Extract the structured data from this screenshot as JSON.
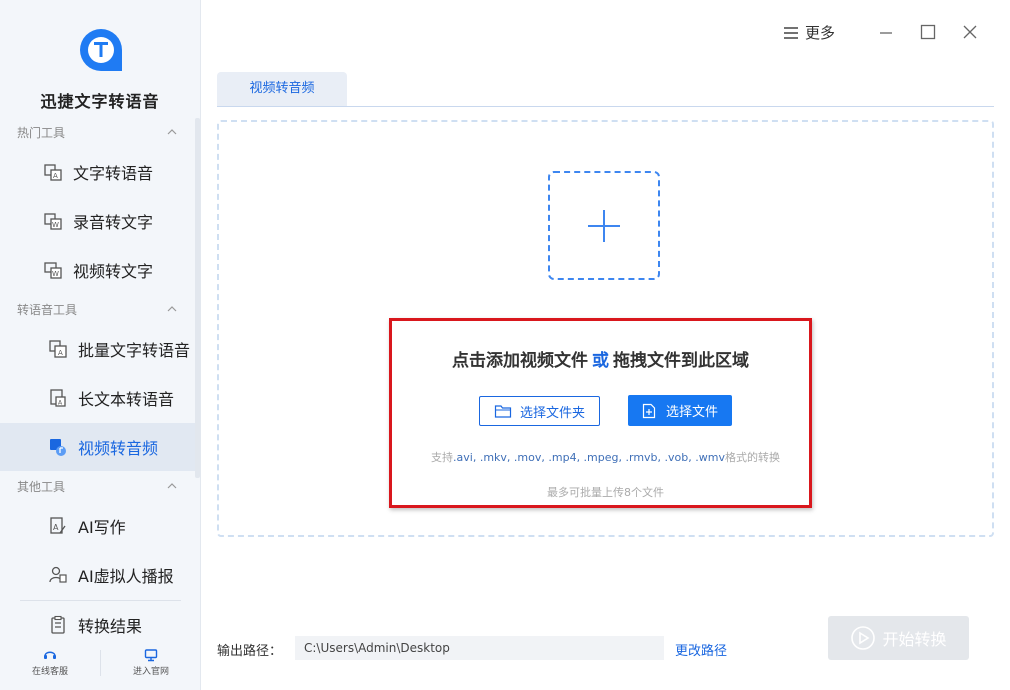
{
  "app": {
    "name": "迅捷文字转语音"
  },
  "sidebar": {
    "groups": [
      {
        "title": "热门工具",
        "items": [
          "文字转语音",
          "录音转文字",
          "视频转文字"
        ]
      },
      {
        "title": "转语音工具",
        "items": [
          "批量文字转语音",
          "长文本转语音",
          "视频转音频"
        ]
      },
      {
        "title": "其他工具",
        "items": [
          "AI写作",
          "AI虚拟人播报",
          "转换结果"
        ]
      }
    ],
    "active_item": "视频转音频",
    "bottom": {
      "service": "在线客服",
      "website": "进入官网"
    }
  },
  "topbar": {
    "more_label": "更多"
  },
  "tabs": [
    {
      "label": "视频转音频"
    }
  ],
  "dropzone": {
    "prompt_part1": "点击添加视频文件",
    "prompt_or": "或",
    "prompt_part2": "拖拽文件到此区域",
    "folder_button": "选择文件夹",
    "file_button": "选择文件",
    "support_prefix": "支持",
    "support_formats": ".avi, .mkv, .mov, .mp4, .mpeg, .rmvb, .vob, .wmv",
    "support_suffix": "格式的转换",
    "limit_text": "最多可批量上传8个文件"
  },
  "output": {
    "label": "输出路径：",
    "path": "C:\\Users\\Admin\\Desktop",
    "change_label": "更改路径"
  },
  "start_button": "开始转换",
  "colors": {
    "accent": "#1a67e0",
    "highlight": "#d9171d",
    "button_blue": "#1778f2"
  }
}
